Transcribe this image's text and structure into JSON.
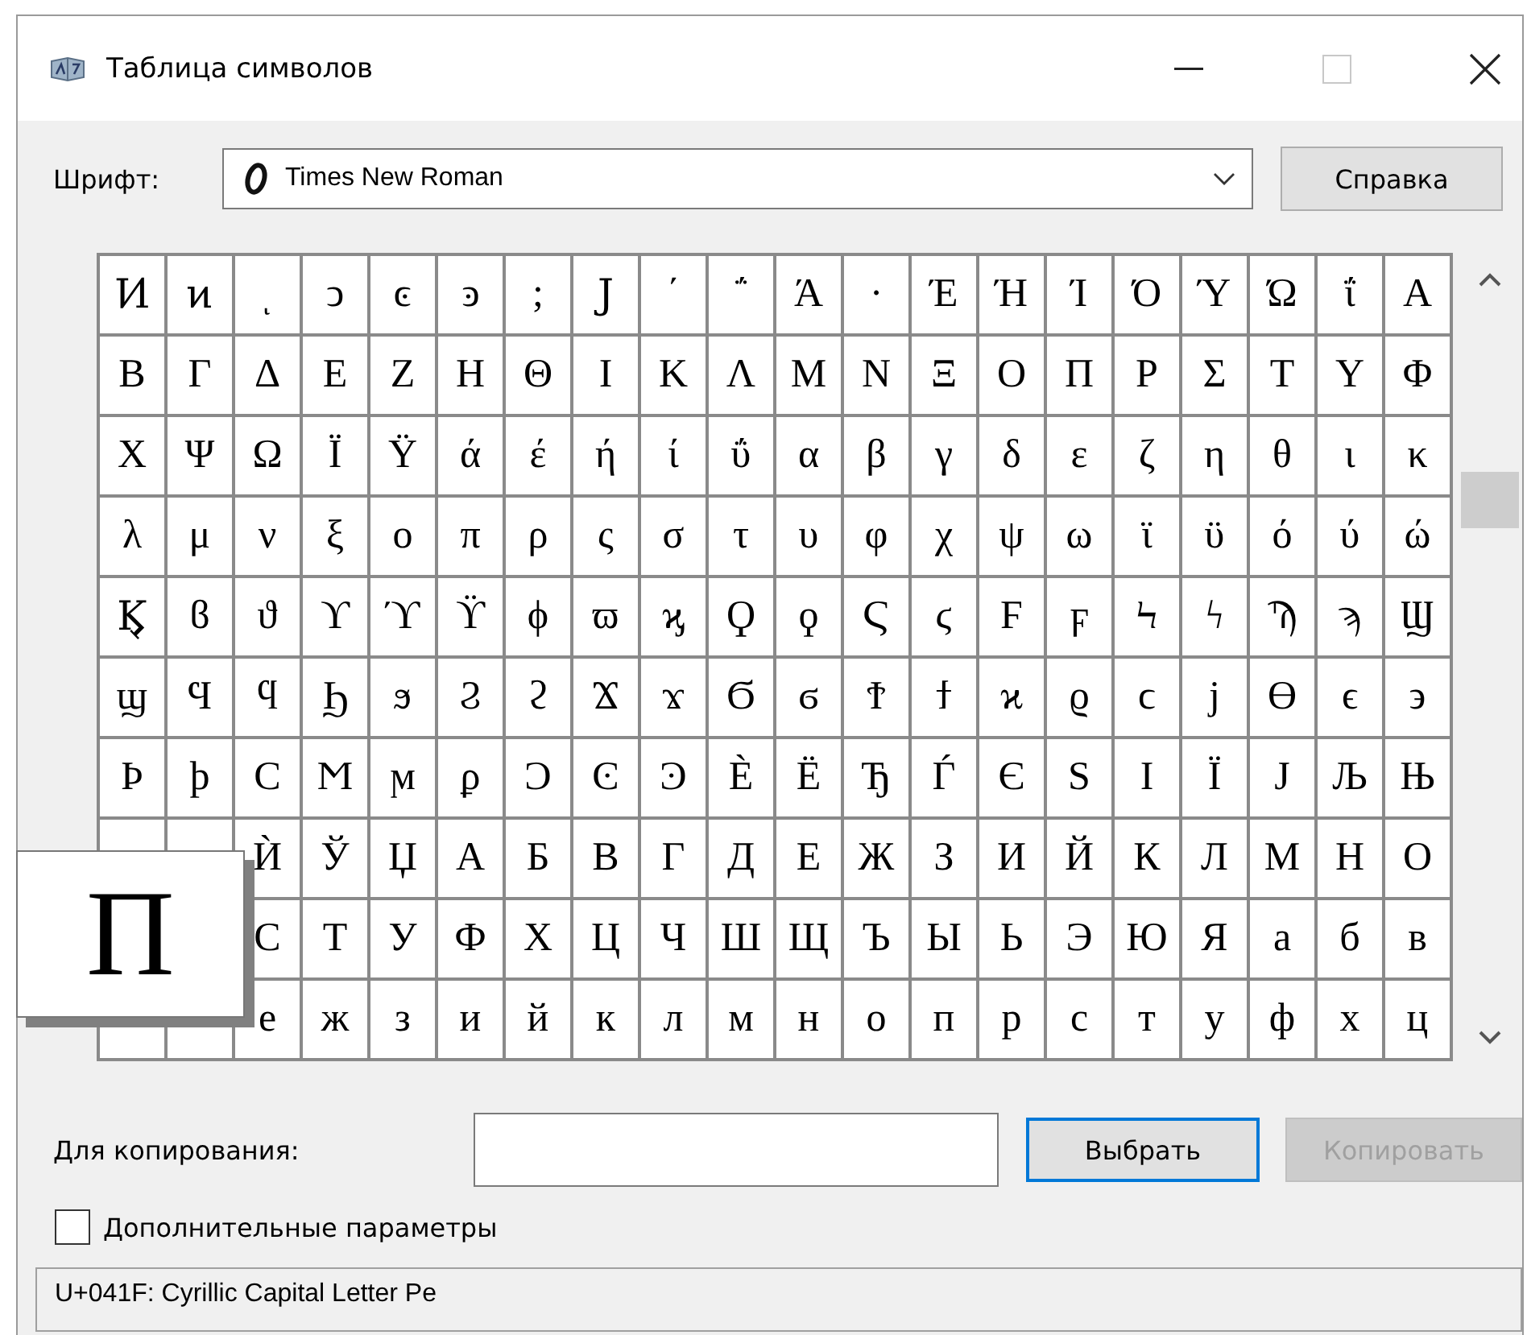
{
  "window": {
    "title": "Таблица символов"
  },
  "font": {
    "label": "Шрифт:",
    "value": "Times New Roman"
  },
  "help_button": {
    "label": "Справка"
  },
  "grid": {
    "rows": [
      [
        "Ͷ",
        "ͷ",
        "ͺ",
        "ͻ",
        "ͼ",
        "ͽ",
        ";",
        "Ϳ",
        "΄",
        "΅",
        "Ά",
        "·",
        "Έ",
        "Ή",
        "Ί",
        "Ό",
        "Ύ",
        "Ώ",
        "ΐ",
        "Α"
      ],
      [
        "Β",
        "Γ",
        "Δ",
        "Ε",
        "Ζ",
        "Η",
        "Θ",
        "Ι",
        "Κ",
        "Λ",
        "Μ",
        "Ν",
        "Ξ",
        "Ο",
        "Π",
        "Ρ",
        "Σ",
        "Τ",
        "Υ",
        "Φ"
      ],
      [
        "Χ",
        "Ψ",
        "Ω",
        "Ϊ",
        "Ϋ",
        "ά",
        "έ",
        "ή",
        "ί",
        "ΰ",
        "α",
        "β",
        "γ",
        "δ",
        "ε",
        "ζ",
        "η",
        "θ",
        "ι",
        "κ"
      ],
      [
        "λ",
        "μ",
        "ν",
        "ξ",
        "ο",
        "π",
        "ρ",
        "ς",
        "σ",
        "τ",
        "υ",
        "φ",
        "χ",
        "ψ",
        "ω",
        "ϊ",
        "ϋ",
        "ό",
        "ύ",
        "ώ"
      ],
      [
        "Ϗ",
        "ϐ",
        "ϑ",
        "ϒ",
        "ϓ",
        "ϔ",
        "ϕ",
        "ϖ",
        "ϗ",
        "Ϙ",
        "ϙ",
        "Ϛ",
        "ϛ",
        "Ϝ",
        "ϝ",
        "Ϟ",
        "ϟ",
        "Ϡ",
        "ϡ",
        "Ϣ"
      ],
      [
        "ϣ",
        "Ϥ",
        "ϥ",
        "Ϧ",
        "ϧ",
        "Ϩ",
        "ϩ",
        "Ϫ",
        "ϫ",
        "Ϭ",
        "ϭ",
        "Ϯ",
        "ϯ",
        "ϰ",
        "ϱ",
        "ϲ",
        "ϳ",
        "ϴ",
        "ϵ",
        "϶"
      ],
      [
        "Ϸ",
        "ϸ",
        "Ϲ",
        "Ϻ",
        "ϻ",
        "ϼ",
        "Ͻ",
        "Ͼ",
        "Ͽ",
        "Ѐ",
        "Ё",
        "Ђ",
        "Ѓ",
        "Є",
        "Ѕ",
        "І",
        "Ї",
        "Ј",
        "Љ",
        "Њ"
      ],
      [
        null,
        null,
        "Ѝ",
        "Ў",
        "Џ",
        "А",
        "Б",
        "В",
        "Г",
        "Д",
        "Е",
        "Ж",
        "З",
        "И",
        "Й",
        "К",
        "Л",
        "М",
        "Н",
        "О"
      ],
      [
        "",
        "",
        "С",
        "Т",
        "У",
        "Ф",
        "Х",
        "Ц",
        "Ч",
        "Ш",
        "Щ",
        "Ъ",
        "Ы",
        "Ь",
        "Э",
        "Ю",
        "Я",
        "а",
        "б",
        "в"
      ],
      [
        null,
        null,
        "е",
        "ж",
        "з",
        "и",
        "й",
        "к",
        "л",
        "м",
        "н",
        "о",
        "п",
        "р",
        "с",
        "т",
        "у",
        "ф",
        "х",
        "ц"
      ]
    ],
    "magnified": "П"
  },
  "copy": {
    "label": "Для копирования:"
  },
  "select_button": {
    "label": "Выбрать",
    "default": true
  },
  "copy_button": {
    "label": "Копировать",
    "disabled": true
  },
  "advanced": {
    "label": "Дополнительные параметры",
    "checked": false
  },
  "status_bar": "U+041F: Cyrillic Capital Letter Pe"
}
